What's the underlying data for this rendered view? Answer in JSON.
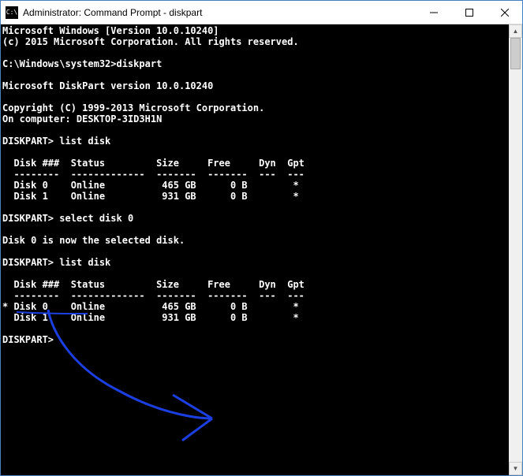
{
  "window": {
    "title": "Administrator: Command Prompt - diskpart"
  },
  "console": {
    "lines": [
      "Microsoft Windows [Version 10.0.10240]",
      "(c) 2015 Microsoft Corporation. All rights reserved.",
      "",
      "C:\\Windows\\system32>diskpart",
      "",
      "Microsoft DiskPart version 10.0.10240",
      "",
      "Copyright (C) 1999-2013 Microsoft Corporation.",
      "On computer: DESKTOP-3ID3H1N",
      "",
      "DISKPART> list disk",
      "",
      "  Disk ###  Status         Size     Free     Dyn  Gpt",
      "  --------  -------------  -------  -------  ---  ---",
      "  Disk 0    Online          465 GB      0 B        *",
      "  Disk 1    Online          931 GB      0 B        *",
      "",
      "DISKPART> select disk 0",
      "",
      "Disk 0 is now the selected disk.",
      "",
      "DISKPART> list disk",
      "",
      "  Disk ###  Status         Size     Free     Dyn  Gpt",
      "  --------  -------------  -------  -------  ---  ---",
      "* Disk 0    Online          465 GB      0 B        *",
      "  Disk 1    Online          931 GB      0 B        *",
      "",
      "DISKPART>"
    ]
  },
  "annotation": {
    "color": "#1b3fe0"
  }
}
